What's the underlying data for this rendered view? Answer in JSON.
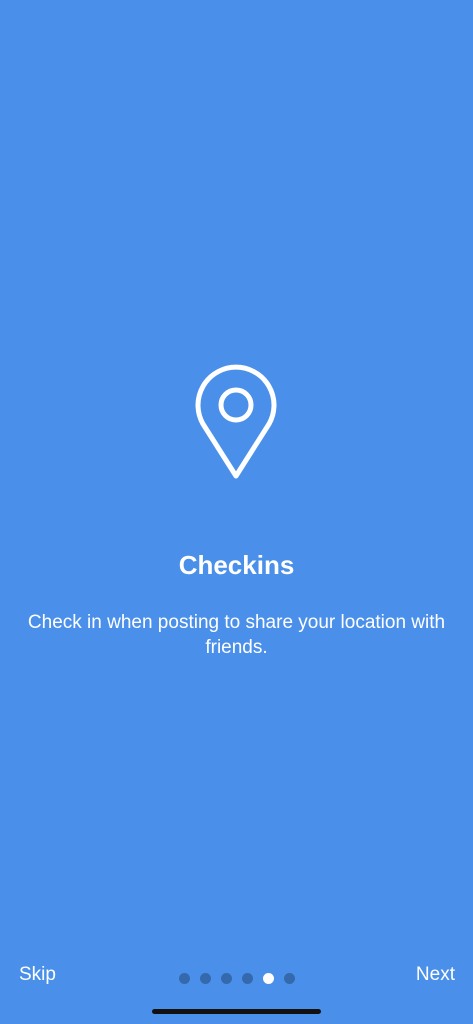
{
  "onboarding": {
    "icon": "location-pin-icon",
    "title": "Checkins",
    "description": "Check in when posting to share your location with friends.",
    "skip_label": "Skip",
    "next_label": "Next",
    "page_count": 6,
    "current_page": 5
  },
  "colors": {
    "background": "#4a90ea",
    "text": "#ffffff",
    "dot_inactive": "#3469ad",
    "dot_active": "#ffffff",
    "home_indicator": "#111111"
  }
}
